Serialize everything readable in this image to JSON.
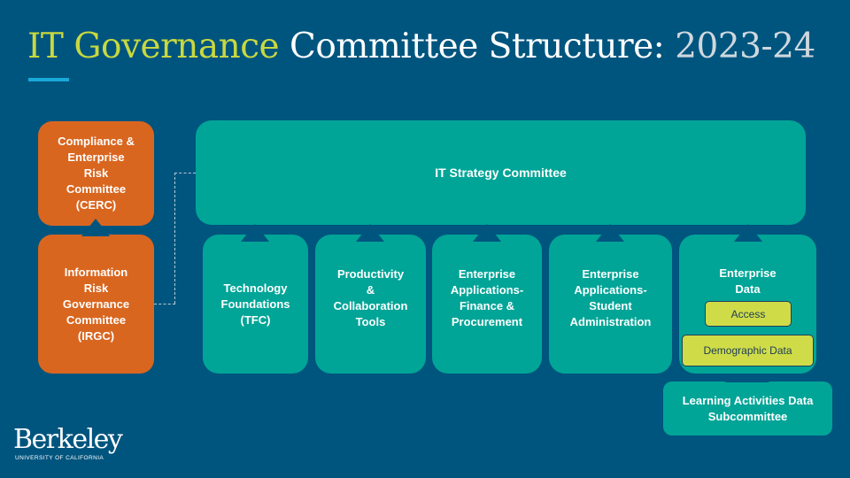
{
  "title": {
    "part1": "IT Governance",
    "part2": " Committee Structure:",
    "part3": " 2023-24"
  },
  "colors": {
    "background": "#00557f",
    "title_accent": "#c8d83f",
    "accent_line": "#19a9d8",
    "risk_boxes": "#d9661f",
    "strategy_boxes": "#00a597",
    "subgroup_pills": "#cfdc48"
  },
  "risk_committees": {
    "cerc": "Compliance &\nEnterprise\nRisk\nCommittee\n(CERC)",
    "irgc": "Information\nRisk\nGovernance\nCommittee\n(IRGC)"
  },
  "strategy": {
    "top": "IT Strategy Committee",
    "subcommittees": [
      "Technology\nFoundations\n(TFC)",
      "Productivity\n&\nCollaboration\nTools",
      "Enterprise\nApplications-\nFinance &\nProcurement",
      "Enterprise\nApplications-\nStudent\nAdministration",
      "Enterprise\nData"
    ],
    "data_groups": [
      "Access",
      "Demographic Data"
    ],
    "learning": "Learning Activities Data\nSubcommittee"
  },
  "logo": {
    "word": "Berkeley",
    "sub": "UNIVERSITY OF CALIFORNIA"
  }
}
